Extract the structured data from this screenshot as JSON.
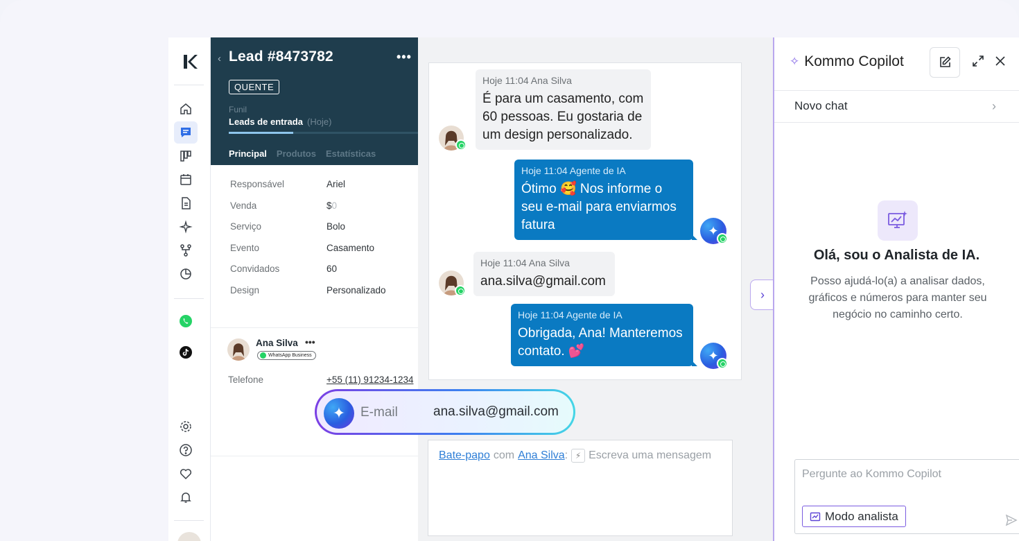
{
  "rail": {
    "icons": [
      "kommo-logo",
      "home-icon",
      "chat-icon",
      "pipeline-icon",
      "calendar-icon",
      "document-icon",
      "sparkle-icon",
      "flow-icon",
      "stats-icon",
      "whatsapp-icon",
      "tiktok-icon",
      "settings-icon",
      "help-icon",
      "heart-icon",
      "bell-icon"
    ]
  },
  "lead": {
    "title": "Lead #8473782",
    "more": "•••",
    "tag": "QUENTE",
    "funnel_label": "Funil",
    "funnel_value": "Leads de entrada",
    "funnel_when": "(Hoje)",
    "funnel_progress": 0.34,
    "tabs": [
      "Principal",
      "Produtos",
      "Estatísticas"
    ],
    "fields": [
      {
        "k": "Responsável",
        "v": "Ariel"
      },
      {
        "k": "Venda",
        "v": "$",
        "muted": "0"
      },
      {
        "k": "Serviço",
        "v": "Bolo"
      },
      {
        "k": "Evento",
        "v": "Casamento"
      },
      {
        "k": "Convidados",
        "v": "60"
      },
      {
        "k": "Design",
        "v": "Personalizado"
      }
    ],
    "contact": {
      "name": "Ana Silva",
      "more": "•••",
      "badge": "WhatsApp Business",
      "phone_label": "Telefone",
      "phone_value": "+55 (11) 91234-1234"
    }
  },
  "chat": {
    "messages": [
      {
        "meta": "Hoje 11:04 Ana Silva",
        "text": "É para um casamento, com 60 pessoas. Eu gostaria de um design personalizado."
      },
      {
        "meta": "Hoje 11:04 Agente de IA",
        "text": "Ótimo 🥰 Nos informe o seu e-mail para enviarmos fatura"
      },
      {
        "meta": "Hoje 11:04 Ana Silva",
        "text": "ana.silva@gmail.com"
      },
      {
        "meta": "Hoje 11:04 Agente de IA",
        "text": "Obrigada, Ana! Manteremos contato. 💕"
      }
    ],
    "extracted": {
      "label": "E-mail",
      "value": "ana.silva@gmail.com"
    },
    "composer": {
      "channel": "Bate-papo",
      "with": "com",
      "contact": "Ana Silva",
      "colon": ":",
      "placeholder": "Escreva uma mensagem"
    }
  },
  "copilot": {
    "title": "Kommo Copilot",
    "new_chat": "Novo chat",
    "hero_title": "Olá, sou o Analista de IA.",
    "hero_desc": "Posso ajudá-lo(a) a analisar dados, gráficos e números para manter seu negócio no caminho certo.",
    "ask_placeholder": "Pergunte ao Kommo Copilot",
    "mode_button": "Modo analista",
    "accent": "#8a6ee8"
  },
  "colors": {
    "lead_header": "#1f3d4d",
    "outgoing_bubble": "#0a7ac2",
    "whatsapp": "#25d366"
  }
}
